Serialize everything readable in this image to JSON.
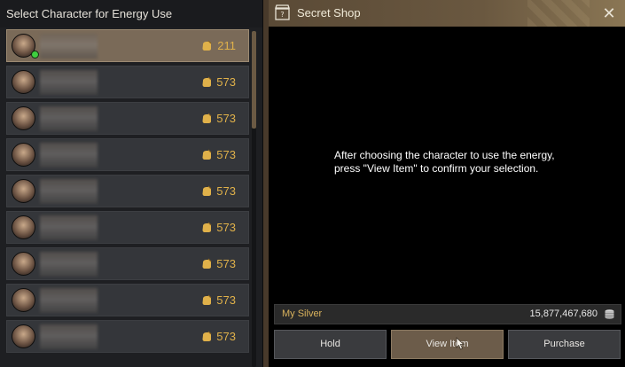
{
  "char_panel": {
    "title": "Select Character for Energy Use",
    "icon": "energy-bag-icon",
    "accent_color": "#e0b14a",
    "characters": [
      {
        "energy": "211",
        "selected": true,
        "online": true
      },
      {
        "energy": "573",
        "selected": false,
        "online": false
      },
      {
        "energy": "573",
        "selected": false,
        "online": false
      },
      {
        "energy": "573",
        "selected": false,
        "online": false
      },
      {
        "energy": "573",
        "selected": false,
        "online": false
      },
      {
        "energy": "573",
        "selected": false,
        "online": false
      },
      {
        "energy": "573",
        "selected": false,
        "online": false
      },
      {
        "energy": "573",
        "selected": false,
        "online": false
      },
      {
        "energy": "573",
        "selected": false,
        "online": false
      }
    ]
  },
  "shop": {
    "title": "Secret Shop",
    "icon": "shop-icon",
    "close_icon": "close-icon",
    "message_line1": "After choosing the character to use the energy,",
    "message_line2": "press \"View Item\" to confirm your selection.",
    "silver_label": "My Silver",
    "silver_value": "15,877,467,680",
    "silver_icon": "silver-coins-icon",
    "buttons": {
      "hold": "Hold",
      "view_item": "View Item",
      "purchase": "Purchase"
    }
  }
}
